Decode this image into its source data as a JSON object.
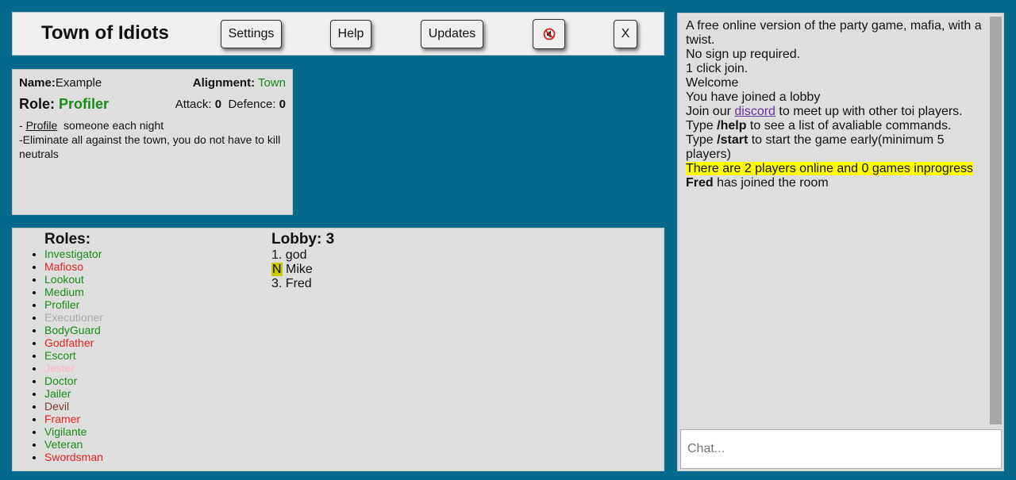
{
  "header": {
    "title": "Town of Idiots",
    "buttons": {
      "settings": "Settings",
      "help": "Help",
      "updates": "Updates",
      "mute_icon": "sound-muted-icon",
      "close": "X"
    }
  },
  "player": {
    "name_label": "Name:",
    "name_value": "Example",
    "alignment_label": "Alignment:",
    "alignment_value": "Town",
    "role_label": "Role:",
    "role_value": "Profiler",
    "attack_label": "Attack:",
    "attack_value": "0",
    "defence_label": "Defence:",
    "defence_value": "0",
    "ability_prefix": "- ",
    "ability_link": "Profile",
    "ability_suffix": "  someone each night",
    "goal": "-Eliminate all against the town, you do not have to kill neutrals"
  },
  "roles": {
    "title": "Roles:",
    "items": [
      {
        "name": "Investigator",
        "color": "#1a8a1a"
      },
      {
        "name": "Mafioso",
        "color": "#ee2222"
      },
      {
        "name": "Lookout",
        "color": "#1a8a1a"
      },
      {
        "name": "Medium",
        "color": "#1a8a1a"
      },
      {
        "name": "Profiler",
        "color": "#1a8a1a"
      },
      {
        "name": "Executioner",
        "color": "#aaaaaa"
      },
      {
        "name": "BodyGuard",
        "color": "#1a8a1a"
      },
      {
        "name": "Godfather",
        "color": "#ee2222"
      },
      {
        "name": "Escort",
        "color": "#1a8a1a"
      },
      {
        "name": "Jester",
        "color": "#ffb6c1"
      },
      {
        "name": "Doctor",
        "color": "#1a8a1a"
      },
      {
        "name": "Jailer",
        "color": "#1a8a1a"
      },
      {
        "name": "Devil",
        "color": "#7a3a2a"
      },
      {
        "name": "Framer",
        "color": "#ee2222"
      },
      {
        "name": "Vigilante",
        "color": "#1a8a1a"
      },
      {
        "name": "Veteran",
        "color": "#1a8a1a"
      },
      {
        "name": "Swordsman",
        "color": "#ee2222"
      }
    ]
  },
  "lobby": {
    "title": "Lobby: 3",
    "players": [
      {
        "prefix": "1.",
        "name": "god"
      },
      {
        "prefix": "N",
        "name": "Mike",
        "tag": true
      },
      {
        "prefix": "3.",
        "name": "Fred"
      }
    ]
  },
  "chat": {
    "messages": {
      "m1": "A free online version of the party game, mafia, with a twist.",
      "m2": "No sign up required.",
      "m3": "1 click join.",
      "m4": "Welcome",
      "m5": "You have joined a lobby",
      "m6_pre": "Join our ",
      "m6_link": "discord",
      "m6_post": " to meet up with other toi players.",
      "m7_pre": "Type ",
      "m7_cmd": "/help",
      "m7_post": " to see a list of avaliable commands.",
      "m8_pre": "Type ",
      "m8_cmd": "/start",
      "m8_post": " to start the game early(minimum 5 players)",
      "m9": "There are 2 players online and 0 games inprogress",
      "m10_name": "Fred",
      "m10_post": " has joined the room"
    },
    "input_placeholder": "Chat..."
  },
  "colors": {
    "background": "#066a8c",
    "panel": "#dedede",
    "town": "#1a8a1a",
    "mafia": "#ee2222",
    "highlight": "#ffff00"
  }
}
